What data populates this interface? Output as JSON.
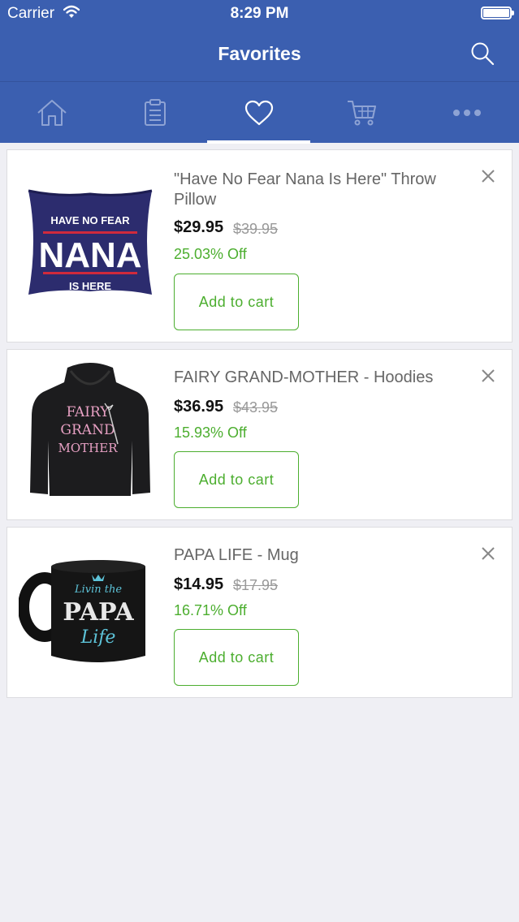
{
  "status_bar": {
    "carrier": "Carrier",
    "time": "8:29 PM"
  },
  "nav": {
    "title": "Favorites"
  },
  "tabs": [
    {
      "icon": "home-icon",
      "active": false
    },
    {
      "icon": "clipboard-icon",
      "active": false
    },
    {
      "icon": "heart-icon",
      "active": true
    },
    {
      "icon": "cart-icon",
      "active": false
    },
    {
      "icon": "more-icon",
      "active": false
    }
  ],
  "colors": {
    "brand": "#3b5fb0",
    "accent": "#4cae2f"
  },
  "items": [
    {
      "name": "\"Have No Fear Nana Is Here\" Throw Pillow",
      "price": "$29.95",
      "original_price": "$39.95",
      "discount": "25.03% Off",
      "button": "Add to cart",
      "image_text": {
        "line1": "HAVE NO FEAR",
        "line2": "NANA",
        "line3": "IS HERE"
      }
    },
    {
      "name": "FAIRY GRAND-MOTHER - Hoodies",
      "price": "$36.95",
      "original_price": "$43.95",
      "discount": "15.93% Off",
      "button": "Add to cart",
      "image_text": {
        "line1": "FAIRY",
        "line2": "GRAND",
        "line3": "MOTHER"
      }
    },
    {
      "name": "PAPA LIFE - Mug",
      "price": "$14.95",
      "original_price": "$17.95",
      "discount": "16.71% Off",
      "button": "Add to cart",
      "image_text": {
        "line1": "Livin the",
        "line2": "PAPA",
        "line3": "Life"
      }
    }
  ]
}
